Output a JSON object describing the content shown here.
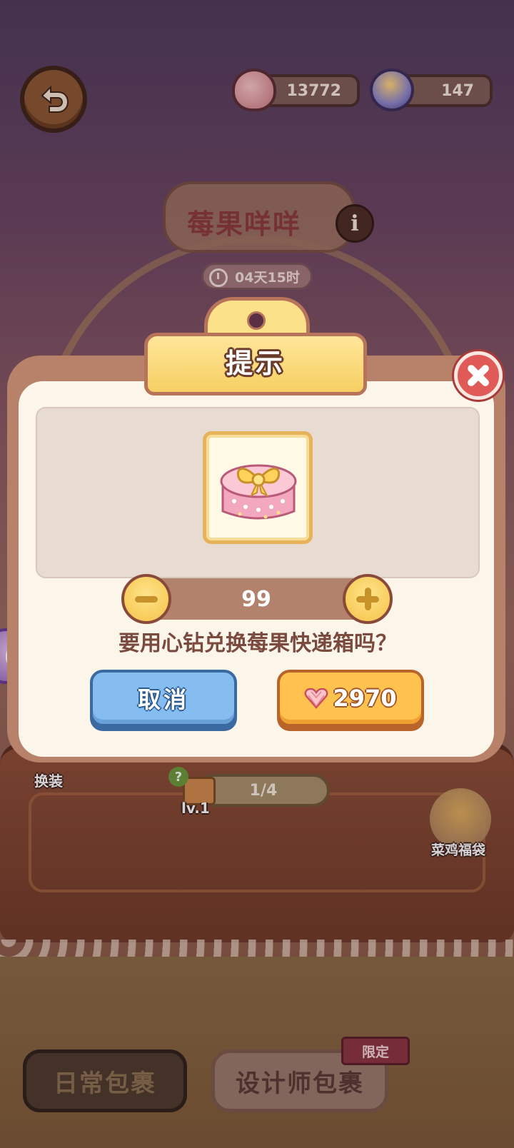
{
  "header": {
    "hearts_value": "13772",
    "potions_value": "147",
    "title": "莓果咩咩",
    "timer": "04天15时"
  },
  "scene": {
    "costume_label": "换装",
    "progress": "1/4",
    "level": "lv.1",
    "lucky_bag_label": "菜鸡福袋"
  },
  "tabs": {
    "daily": "日常包裹",
    "designer": "设计师包裹",
    "limited_tag": "限定"
  },
  "dialog": {
    "title": "提示",
    "quantity": "99",
    "question": "要用心钻兑换莓果快递箱吗？",
    "cancel_label": "取消",
    "cost_value": "2970",
    "item_icon": "gift-box-icon"
  },
  "colors": {
    "cancel_button": "#86bdf0",
    "confirm_button": "#ffc24e",
    "close_button": "#e05a58",
    "dialog_frame": "#b8816a",
    "dialog_body": "#fbf5ea"
  }
}
